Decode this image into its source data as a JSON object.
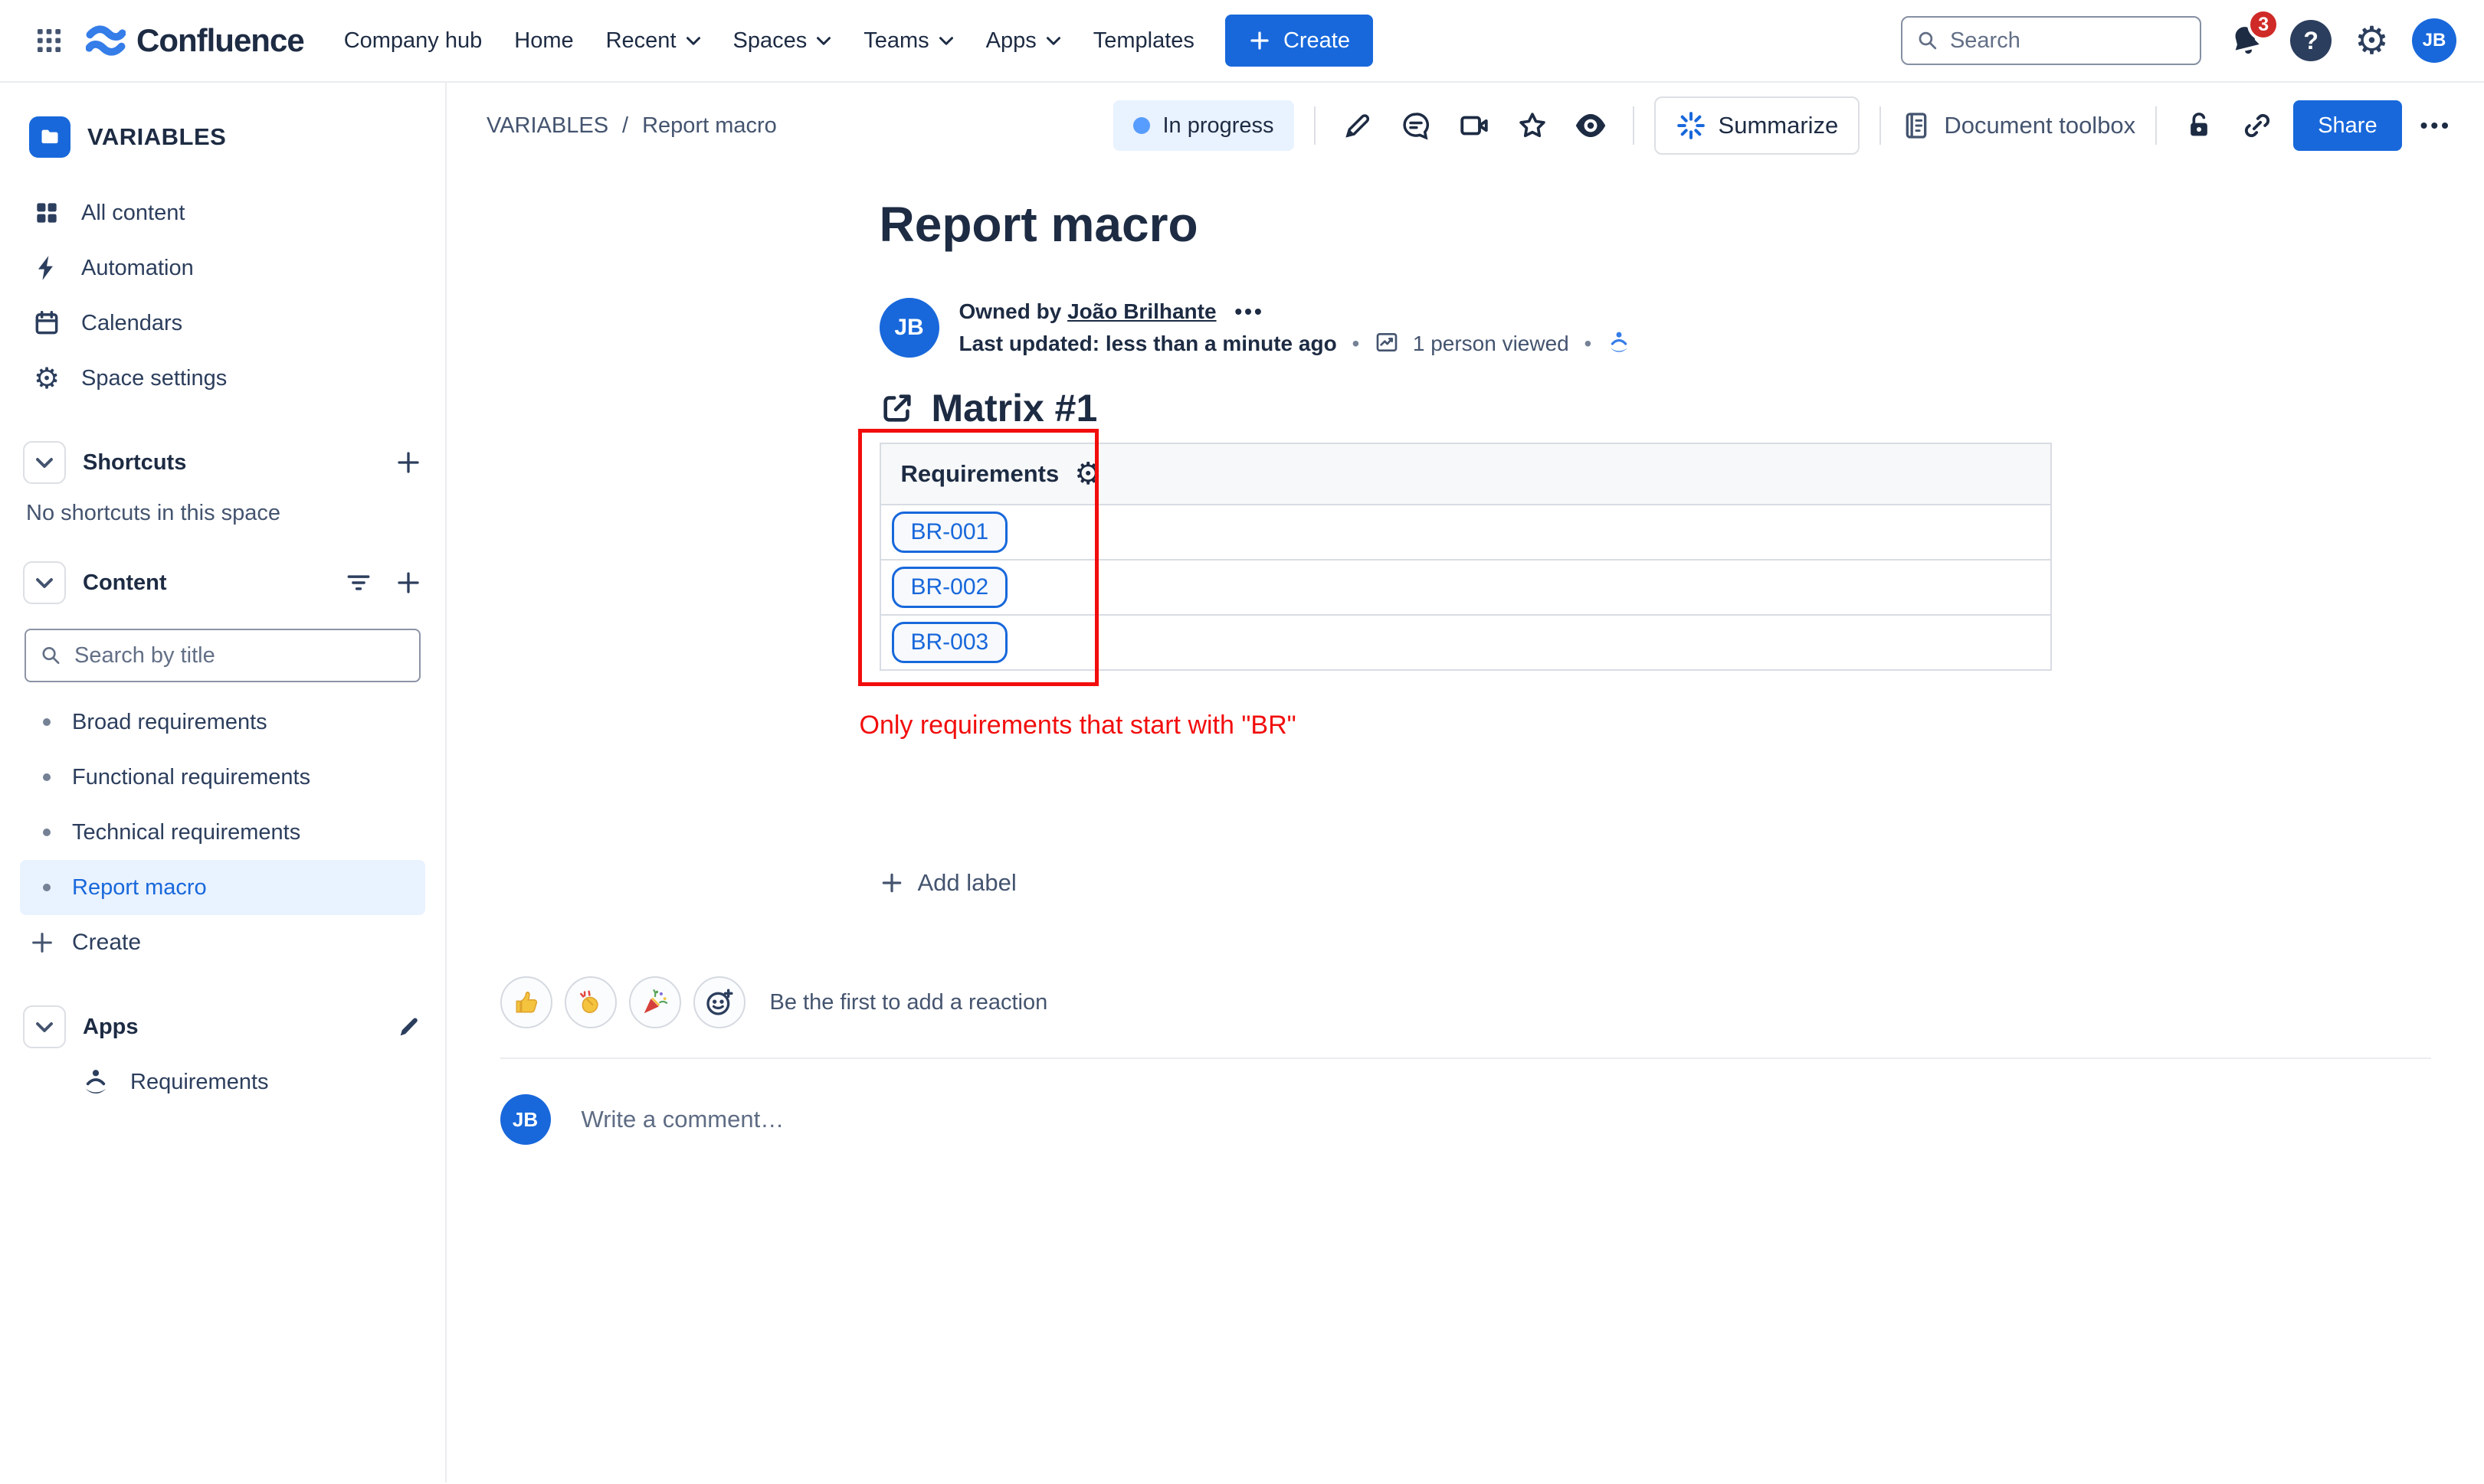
{
  "topbar": {
    "product_name": "Confluence",
    "nav": [
      {
        "label": "Company hub"
      },
      {
        "label": "Home"
      },
      {
        "label": "Recent"
      },
      {
        "label": "Spaces"
      },
      {
        "label": "Teams"
      },
      {
        "label": "Apps"
      },
      {
        "label": "Templates"
      }
    ],
    "create_label": "Create",
    "search_placeholder": "Search",
    "notification_count": "3",
    "help_label": "?",
    "avatar_initials": "JB"
  },
  "sidebar": {
    "space_name": "VARIABLES",
    "nav_items": [
      {
        "label": "All content"
      },
      {
        "label": "Automation"
      },
      {
        "label": "Calendars"
      },
      {
        "label": "Space settings"
      }
    ],
    "shortcuts_title": "Shortcuts",
    "shortcuts_empty": "No shortcuts in this space",
    "content_title": "Content",
    "content_search_placeholder": "Search by title",
    "pages": [
      {
        "label": "Broad requirements"
      },
      {
        "label": "Functional requirements"
      },
      {
        "label": "Technical requirements"
      },
      {
        "label": "Report macro"
      }
    ],
    "create_label": "Create",
    "apps_title": "Apps",
    "app_items": [
      {
        "label": "Requirements"
      }
    ]
  },
  "content_header": {
    "breadcrumb": {
      "space": "VARIABLES",
      "separator": "/",
      "page": "Report macro"
    },
    "status_label": "In progress",
    "summarize_label": "Summarize",
    "document_toolbox_label": "Document toolbox",
    "share_label": "Share",
    "more_label": "•••"
  },
  "page": {
    "title": "Report macro",
    "byline": {
      "avatar_initials": "JB",
      "owned_by_prefix": "Owned by",
      "owner_name": "João Brilhante",
      "owner_more": "•••",
      "last_updated": "Last updated: less than a minute ago",
      "separator": "•",
      "views_label": "1 person viewed"
    },
    "section_title": "Matrix #1",
    "table": {
      "header_label": "Requirements",
      "rows": [
        {
          "id": "BR-001"
        },
        {
          "id": "BR-002"
        },
        {
          "id": "BR-003"
        }
      ]
    },
    "annotation_text": "Only requirements that start with \"BR\"",
    "add_label_text": "Add label"
  },
  "reactions": {
    "buttons": [
      {
        "name": "thumbs-up"
      },
      {
        "name": "clap"
      },
      {
        "name": "party-popper"
      },
      {
        "name": "add-reaction"
      }
    ],
    "prompt": "Be the first to add a reaction"
  },
  "comments": {
    "avatar_initials": "JB",
    "placeholder": "Write a comment…"
  },
  "icons": {
    "app_switcher": "3x3-dot-grid",
    "confluence_logo": "two-blue-waves",
    "chevron_down": "⌄",
    "search": "magnifier",
    "notifications": "bell",
    "help": "?",
    "settings": "⚙",
    "space_avatar": "folder",
    "all_content": "2x2-grid",
    "automation": "lightning-bolt",
    "calendars": "calendar",
    "space_settings": "⚙",
    "add": "+",
    "filter": "filter-lines",
    "edit": "pencil",
    "requirements_app": "meditating-person",
    "status_dot": "●",
    "page_edit": "pencil",
    "page_comments": "speech-bubble",
    "page_video": "video-camera",
    "page_star": "star-outline",
    "page_watch": "filled-eye",
    "summarize": "blue-sparkle",
    "document_toolbox": "document",
    "unlock": "open-padlock",
    "copy_link": "chain-link",
    "analytics": "trend-line",
    "table_settings": "⚙",
    "external_link": "box-arrow",
    "add_reaction": "smiley-plus",
    "bullet": "•"
  },
  "colors": {
    "brand_blue": "#1868DB",
    "logo_blue": "#357DE8",
    "text_primary": "#1D2B43",
    "text_secondary": "#44546F",
    "text_muted": "#626F86",
    "selected_bg": "#E9F2FF",
    "status_bg": "#E9F2FF",
    "status_dot": "#579DFF",
    "border_light": "#EBECF0",
    "border_mid": "#DCDFE4",
    "table_border": "#D8DCE3",
    "table_header_bg": "#F7F8F9",
    "chip_blue": "#1868DB",
    "chip_bg": "#F7F9FC",
    "annotation_red": "#F20D0D",
    "badge_red": "#CF2A27"
  }
}
